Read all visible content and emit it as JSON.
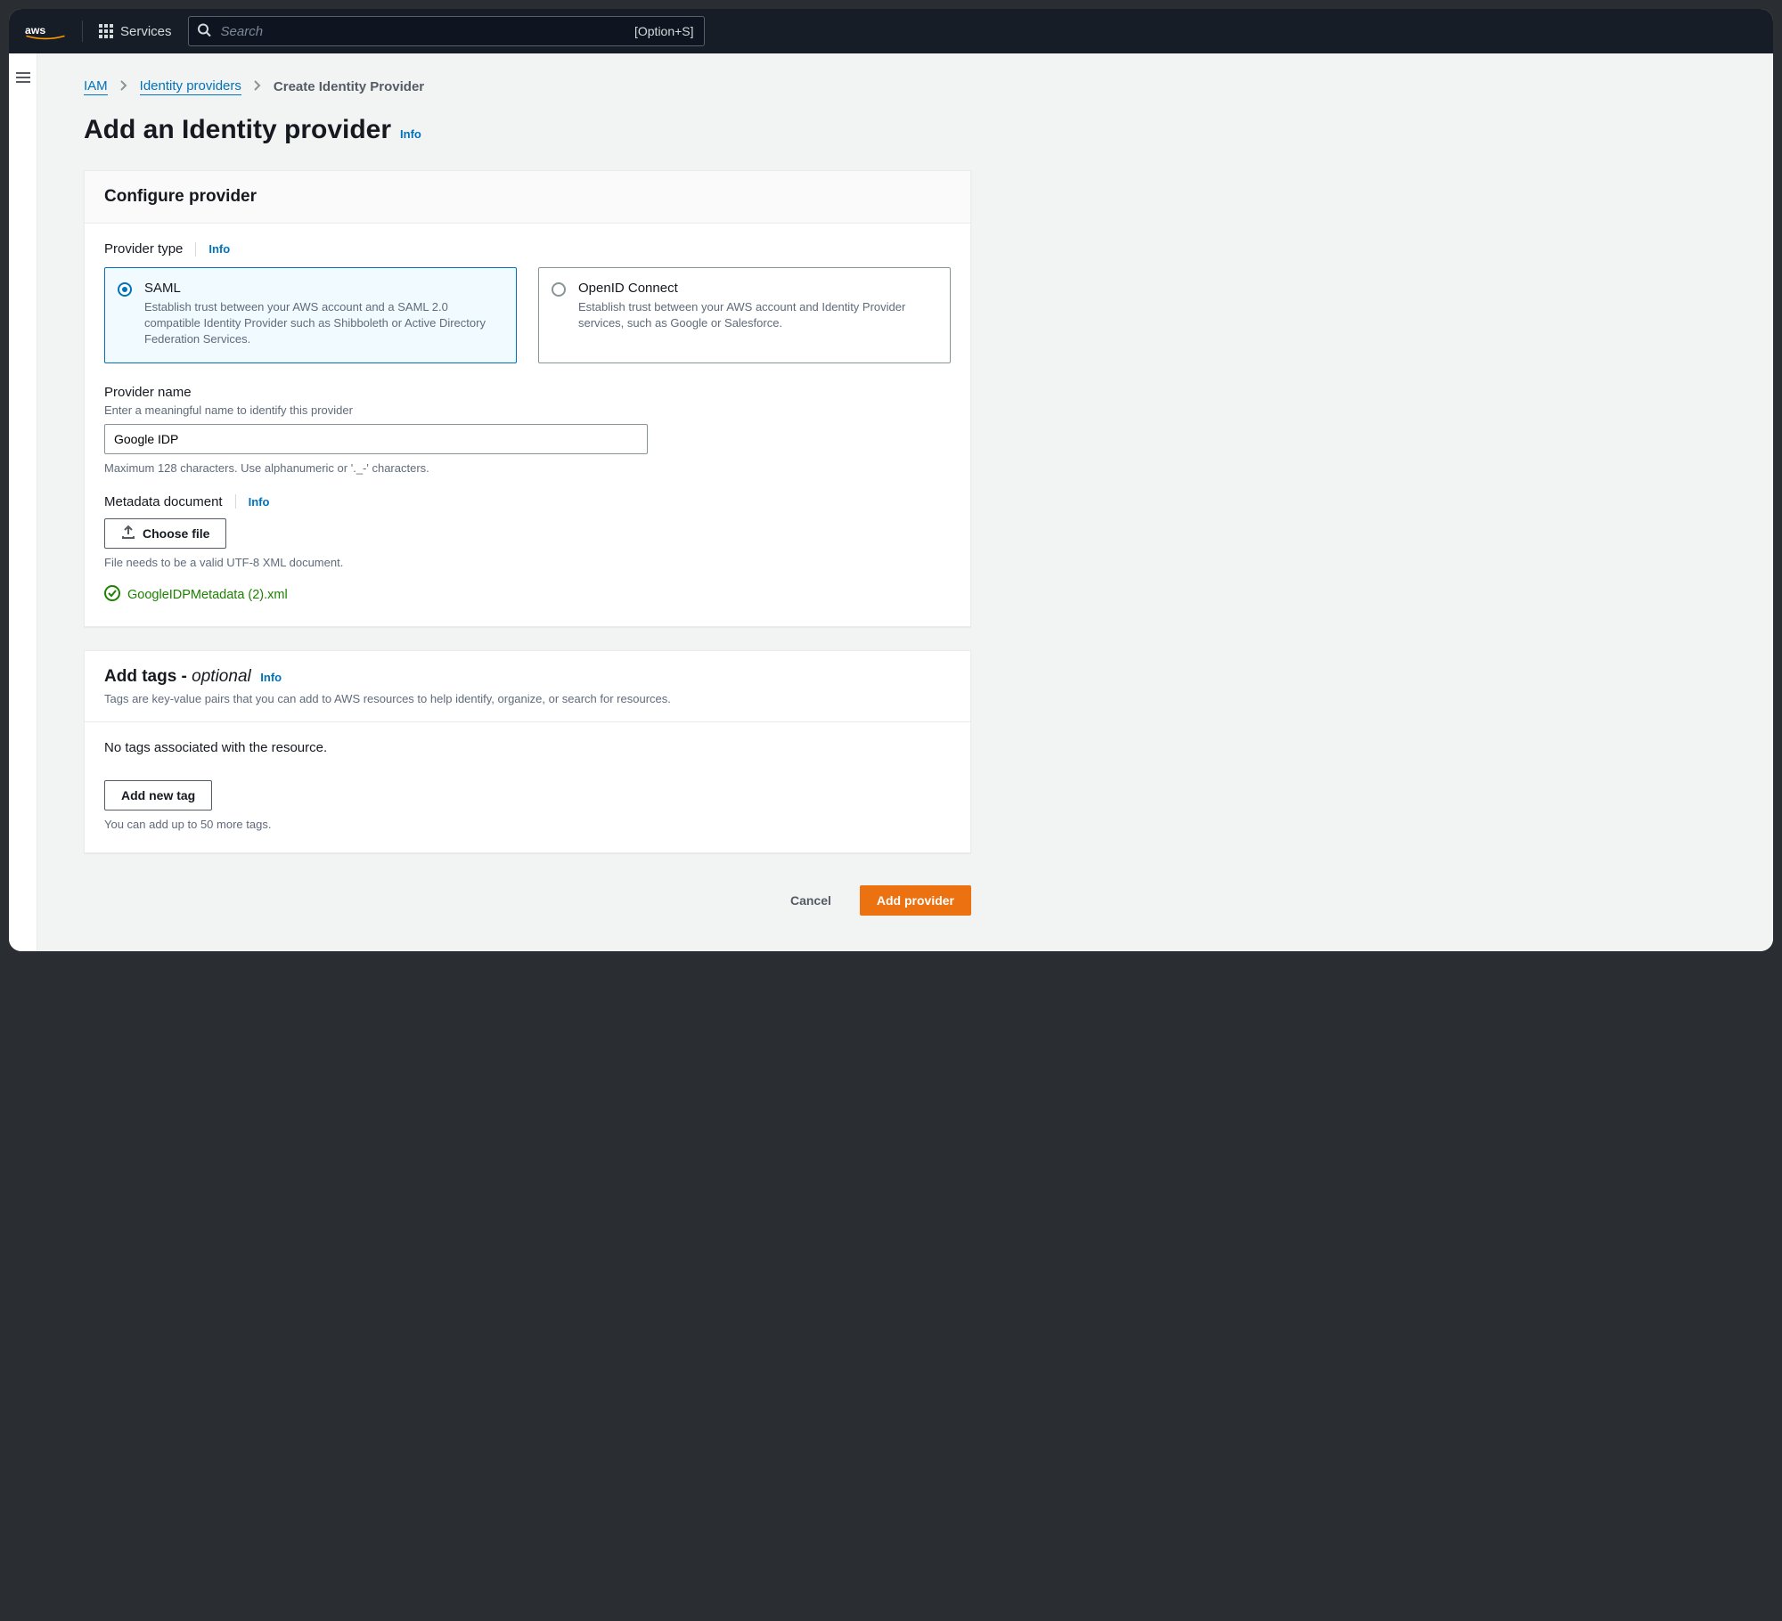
{
  "nav": {
    "services_label": "Services",
    "search_placeholder": "Search",
    "search_shortcut": "[Option+S]"
  },
  "breadcrumb": {
    "items": [
      "IAM",
      "Identity providers",
      "Create Identity Provider"
    ]
  },
  "page": {
    "title": "Add an Identity provider",
    "info": "Info"
  },
  "configure": {
    "title": "Configure provider",
    "provider_type_label": "Provider type",
    "info": "Info",
    "options": [
      {
        "title": "SAML",
        "desc": "Establish trust between your AWS account and a SAML 2.0 compatible Identity Provider such as Shibboleth or Active Directory Federation Services.",
        "selected": true
      },
      {
        "title": "OpenID Connect",
        "desc": "Establish trust between your AWS account and Identity Provider services, such as Google or Salesforce.",
        "selected": false
      }
    ],
    "provider_name": {
      "label": "Provider name",
      "hint": "Enter a meaningful name to identify this provider",
      "value": "Google IDP",
      "constraint": "Maximum 128 characters. Use alphanumeric or '._-' characters."
    },
    "metadata": {
      "label": "Metadata document",
      "info": "Info",
      "choose_file": "Choose file",
      "hint": "File needs to be a valid UTF-8 XML document.",
      "uploaded_file": "GoogleIDPMetadata (2).xml"
    }
  },
  "tags": {
    "title_prefix": "Add tags - ",
    "title_optional": "optional",
    "info": "Info",
    "sub": "Tags are key-value pairs that you can add to AWS resources to help identify, organize, or search for resources.",
    "empty": "No tags associated with the resource.",
    "add_btn": "Add new tag",
    "limit": "You can add up to 50 more tags."
  },
  "actions": {
    "cancel": "Cancel",
    "add_provider": "Add provider"
  }
}
